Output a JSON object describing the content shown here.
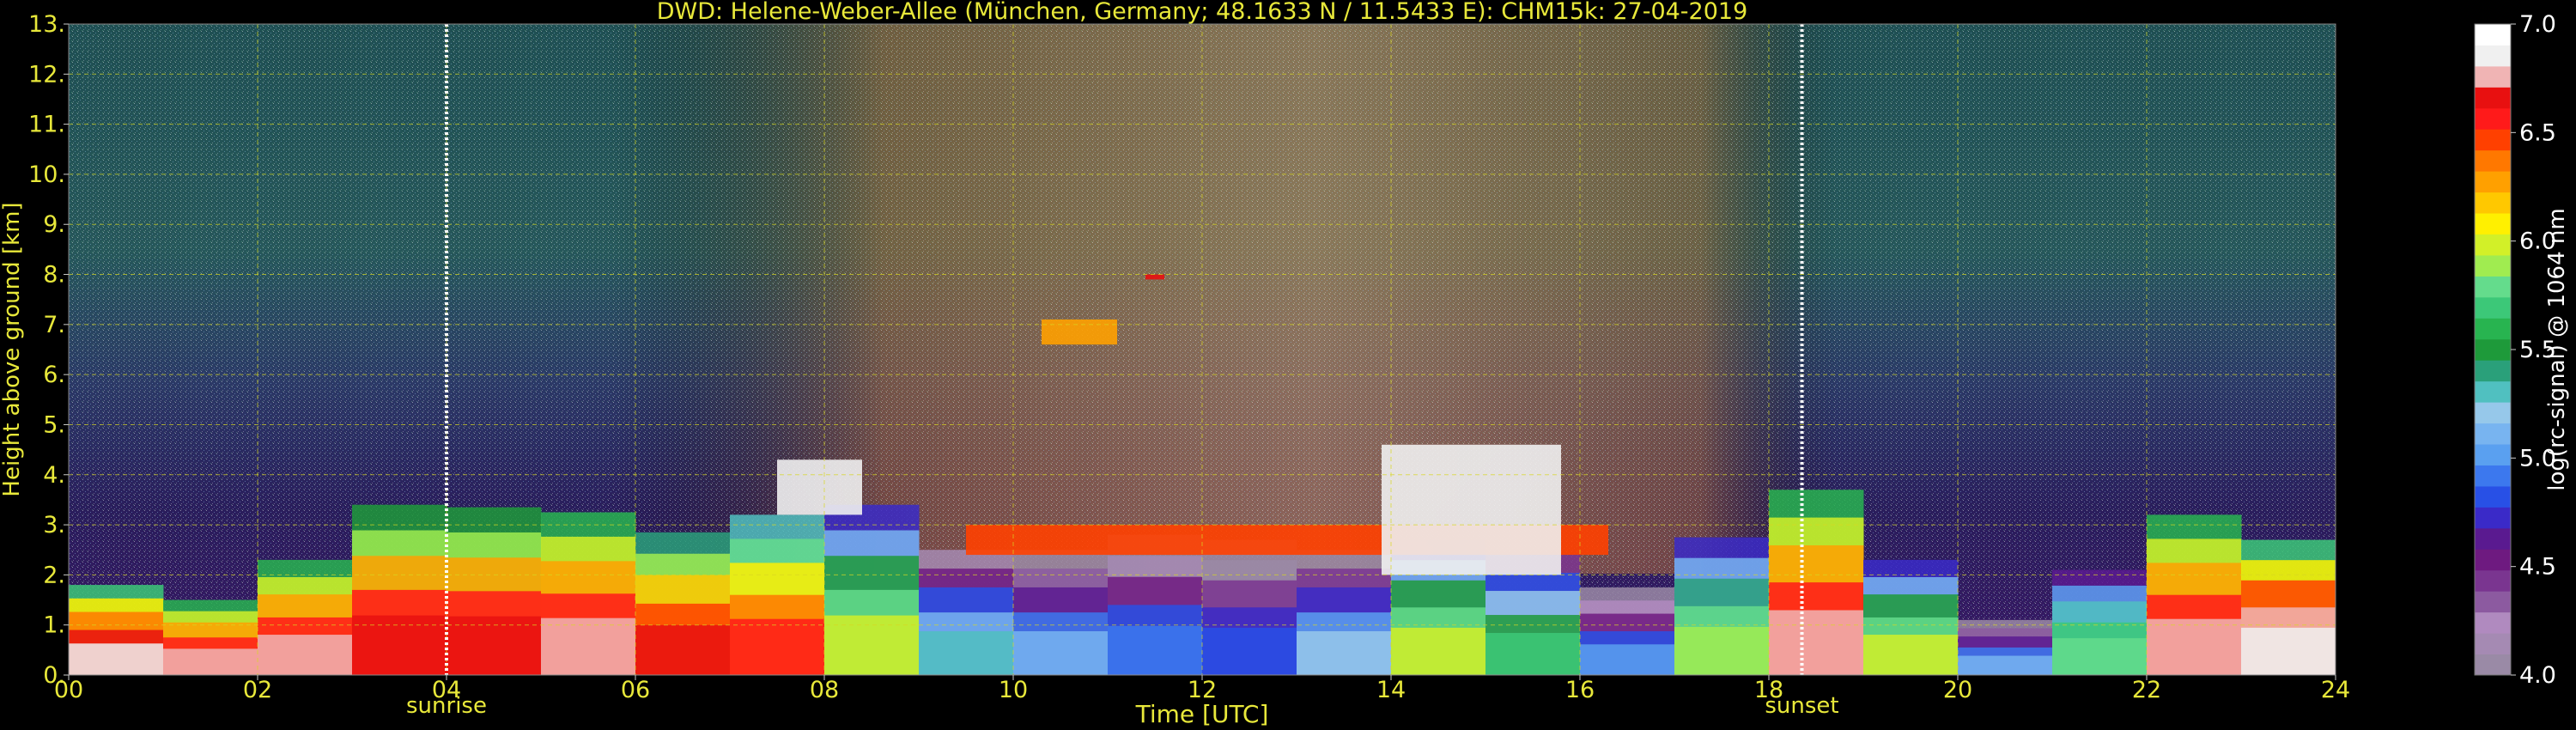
{
  "chart_data": {
    "type": "heatmap",
    "title": "DWD: Helene-Weber-Allee (München, Germany; 48.1633 N / 11.5433 E):    CHM15k: 27-04-2019",
    "xlabel": "Time [UTC]",
    "ylabel": "Height above ground [km]",
    "colorbar_label": "log(rc-signal) @ 1064 nm",
    "x_unit": "hour UTC",
    "y_unit": "km",
    "xlim": [
      0,
      24
    ],
    "ylim": [
      0,
      13
    ],
    "x_ticks": [
      {
        "v": 0,
        "label": "00"
      },
      {
        "v": 2,
        "label": "02"
      },
      {
        "v": 4,
        "label": "04"
      },
      {
        "v": 6,
        "label": "06"
      },
      {
        "v": 8,
        "label": "08"
      },
      {
        "v": 10,
        "label": "10"
      },
      {
        "v": 12,
        "label": "12"
      },
      {
        "v": 14,
        "label": "14"
      },
      {
        "v": 16,
        "label": "16"
      },
      {
        "v": 18,
        "label": "18"
      },
      {
        "v": 20,
        "label": "20"
      },
      {
        "v": 22,
        "label": "22"
      },
      {
        "v": 24,
        "label": "24"
      }
    ],
    "y_ticks": [
      {
        "v": 0,
        "label": "0."
      },
      {
        "v": 1,
        "label": "1."
      },
      {
        "v": 2,
        "label": "2."
      },
      {
        "v": 3,
        "label": "3."
      },
      {
        "v": 4,
        "label": "4."
      },
      {
        "v": 5,
        "label": "5."
      },
      {
        "v": 6,
        "label": "6."
      },
      {
        "v": 7,
        "label": "7."
      },
      {
        "v": 8,
        "label": "8."
      },
      {
        "v": 9,
        "label": "9."
      },
      {
        "v": 10,
        "label": "10."
      },
      {
        "v": 11,
        "label": "11."
      },
      {
        "v": 12,
        "label": "12."
      },
      {
        "v": 13,
        "label": "13."
      }
    ],
    "grid": true,
    "markers": [
      {
        "label": "sunrise",
        "time": 4.0
      },
      {
        "label": "sunset",
        "time": 18.35
      }
    ],
    "colorbar": {
      "range": [
        4.0,
        7.0
      ],
      "ticks": [
        {
          "v": 4.0,
          "label": "4.0"
        },
        {
          "v": 4.5,
          "label": "4.5"
        },
        {
          "v": 5.0,
          "label": "5.0"
        },
        {
          "v": 5.5,
          "label": "5.5"
        },
        {
          "v": 6.0,
          "label": "6.0"
        },
        {
          "v": 6.5,
          "label": "6.5"
        },
        {
          "v": 7.0,
          "label": "7.0"
        }
      ],
      "colors": [
        "#9a8aa6",
        "#a58ab3",
        "#b08abf",
        "#8c5aa0",
        "#7a3590",
        "#6e1a80",
        "#5a1a90",
        "#3a2ac8",
        "#2850e6",
        "#3c78ee",
        "#5aa0f0",
        "#78b4f0",
        "#96c8ea",
        "#50c0c0",
        "#2aa07a",
        "#1e9a3a",
        "#28b450",
        "#3cc878",
        "#64dc8c",
        "#a0ec50",
        "#d2f028",
        "#fff000",
        "#ffc800",
        "#ffa000",
        "#ff7800",
        "#ff4000",
        "#ff1a1a",
        "#e81010",
        "#f0b4b4",
        "#f0f0f0",
        "#ffffff"
      ]
    },
    "layers": [
      {
        "feature": "boundary layer",
        "times": [
          0,
          1,
          2,
          3,
          4,
          5,
          6,
          7,
          8,
          9,
          10,
          11,
          12,
          13,
          14,
          15,
          16,
          17,
          18,
          19,
          20,
          21,
          22,
          23,
          24
        ],
        "top_km": [
          1.9,
          1.7,
          1.3,
          3.3,
          3.5,
          3.2,
          3.3,
          2.4,
          4.0,
          2.8,
          2.2,
          2.8,
          2.8,
          2.6,
          2.4,
          3.0,
          1.8,
          1.7,
          3.8,
          3.6,
          1.0,
          1.2,
          3.0,
          3.4,
          2.0
        ],
        "peak_log": [
          6.9,
          6.8,
          6.7,
          6.8,
          6.6,
          6.8,
          6.7,
          6.6,
          6.5,
          5.4,
          5.2,
          5.0,
          4.9,
          4.8,
          5.6,
          6.3,
          5.0,
          5.0,
          6.8,
          6.7,
          5.2,
          5.0,
          6.6,
          6.9,
          6.9
        ]
      }
    ],
    "clouds": [
      {
        "t0": 7.5,
        "t1": 8.4,
        "base_km": 3.2,
        "top_km": 4.3,
        "log": 6.9
      },
      {
        "t0": 9.5,
        "t1": 16.3,
        "base_km": 2.4,
        "top_km": 3.0,
        "log": 6.5
      },
      {
        "t0": 13.9,
        "t1": 15.8,
        "base_km": 2.0,
        "top_km": 4.6,
        "log": 6.9
      },
      {
        "t0": 10.3,
        "t1": 11.1,
        "base_km": 6.6,
        "top_km": 7.1,
        "log": 6.3
      },
      {
        "t0": 11.4,
        "t1": 11.6,
        "base_km": 7.9,
        "top_km": 8.0,
        "log": 6.7
      }
    ]
  }
}
